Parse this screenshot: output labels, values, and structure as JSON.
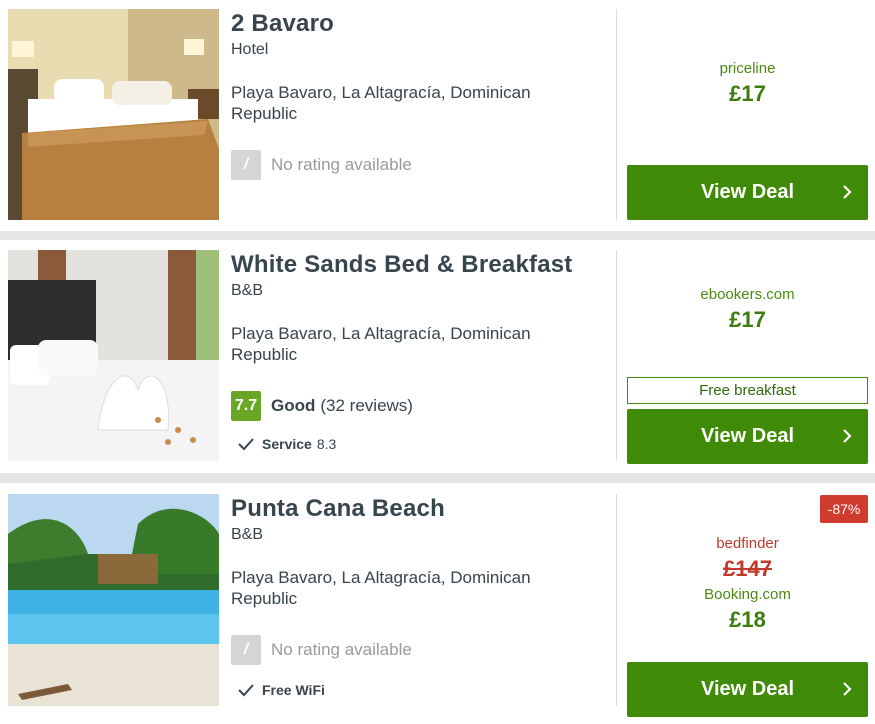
{
  "listings": [
    {
      "name": "2 Bavaro",
      "type": "Hotel",
      "address": "Playa Bavaro, La Altagracía, Dominican Republic",
      "rating_placeholder": "/",
      "rating_text": "No rating available",
      "provider": "priceline",
      "price": "£17",
      "cta": "View Deal"
    },
    {
      "name": "White Sands Bed & Breakfast",
      "type": "B&B",
      "address": "Playa Bavaro, La Altagracía, Dominican Republic",
      "score": "7.7",
      "score_word": "Good",
      "reviews": "(32 reviews)",
      "feature_label": "Service",
      "feature_value": "8.3",
      "provider": "ebookers.com",
      "price": "£17",
      "perk": "Free breakfast",
      "cta": "View Deal"
    },
    {
      "name": "Punta Cana Beach",
      "type": "B&B",
      "address": "Playa Bavaro, La Altagracía, Dominican Republic",
      "rating_placeholder": "/",
      "rating_text": "No rating available",
      "feature_label": "Free WiFi",
      "discount": "-87%",
      "old_provider": "bedfinder",
      "old_price": "£147",
      "provider": "Booking.com",
      "price": "£18",
      "cta": "View Deal"
    }
  ],
  "colors": {
    "deal_button": "#3f8a06",
    "price_green": "#3c7d0e",
    "rating_good": "#6aa626",
    "discount_red": "#d03b2e"
  },
  "icons": [
    "check-icon",
    "chevron-right-icon"
  ]
}
